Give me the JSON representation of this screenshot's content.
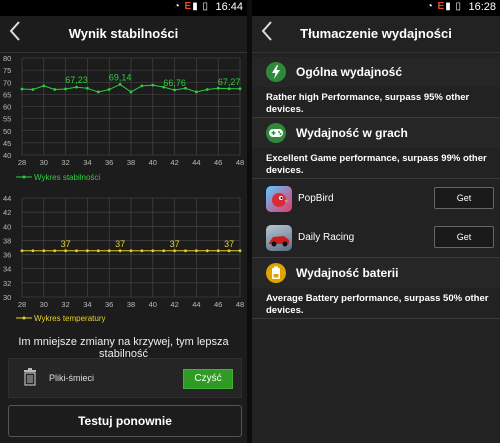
{
  "left": {
    "status": {
      "time": "16:44",
      "network": "E"
    },
    "title": "Wynik stabilności",
    "stability_chart": {
      "y_ticks": [
        "80",
        "75",
        "70",
        "65",
        "60",
        "55",
        "50",
        "45",
        "40"
      ],
      "x_ticks": [
        "28",
        "30",
        "32",
        "34",
        "36",
        "38",
        "40",
        "42",
        "44",
        "46",
        "48"
      ],
      "labels": [
        "67,23",
        "69,14",
        "66,76",
        "67,27"
      ],
      "legend": "Wykres stabilności"
    },
    "temperature_chart": {
      "y_ticks": [
        "44",
        "42",
        "40",
        "38",
        "36",
        "34",
        "32",
        "30"
      ],
      "x_ticks": [
        "28",
        "30",
        "32",
        "34",
        "36",
        "38",
        "40",
        "42",
        "44",
        "46",
        "48"
      ],
      "labels": [
        "37",
        "37",
        "37",
        "37"
      ],
      "legend": "Wykres temperatury"
    },
    "hint": "Im mniejsze zmiany na krzywej, tym lepsza stabilność",
    "junk": {
      "label": "Pliki-śmieci",
      "button": "Czyść"
    },
    "retest": "Testuj ponownie"
  },
  "right": {
    "status": {
      "time": "16:28",
      "network": "E"
    },
    "title": "Tłumaczenie wydajności",
    "overall": {
      "label": "Ogólna wydajność",
      "desc": "Rather high Performance, surpass 95% other devices."
    },
    "games": {
      "label": "Wydajność w grach",
      "desc": "Excellent Game performance, surpass 99% other devices."
    },
    "apps": [
      {
        "name": "PopBird",
        "button": "Get"
      },
      {
        "name": "Daily Racing",
        "button": "Get"
      }
    ],
    "battery": {
      "label": "Wydajność baterii",
      "desc": "Average Battery performance, surpass 50% other devices."
    }
  },
  "chart_data": [
    {
      "type": "line",
      "x": [
        28,
        29,
        30,
        31,
        32,
        33,
        34,
        35,
        36,
        37,
        38,
        39,
        40,
        41,
        42,
        43,
        44,
        45,
        46,
        47,
        48
      ],
      "series": [
        {
          "name": "Wykres stabilności",
          "values": [
            67.2,
            67,
            68.5,
            67,
            67.2,
            68,
            67.5,
            66,
            67,
            69.1,
            66,
            68.5,
            68.8,
            68,
            66.8,
            67.5,
            66,
            67,
            67.5,
            67.3,
            67.3
          ]
        }
      ],
      "xlim": [
        28,
        48
      ],
      "ylim": [
        40,
        80
      ],
      "annotations": [
        "67,23",
        "69,14",
        "66,76",
        "67,27"
      ],
      "color": "#2ecc40"
    },
    {
      "type": "line",
      "x": [
        28,
        29,
        30,
        31,
        32,
        33,
        34,
        35,
        36,
        37,
        38,
        39,
        40,
        41,
        42,
        43,
        44,
        45,
        46,
        47,
        48
      ],
      "series": [
        {
          "name": "Wykres temperatury",
          "values": [
            37,
            37,
            37,
            37,
            37,
            37,
            37,
            37,
            37,
            37,
            37,
            37,
            37,
            37,
            37,
            37,
            37,
            37,
            37,
            37,
            37
          ]
        }
      ],
      "xlim": [
        28,
        48
      ],
      "ylim": [
        30,
        45
      ],
      "annotations": [
        "37",
        "37",
        "37",
        "37"
      ],
      "color": "#e6d22a"
    }
  ]
}
